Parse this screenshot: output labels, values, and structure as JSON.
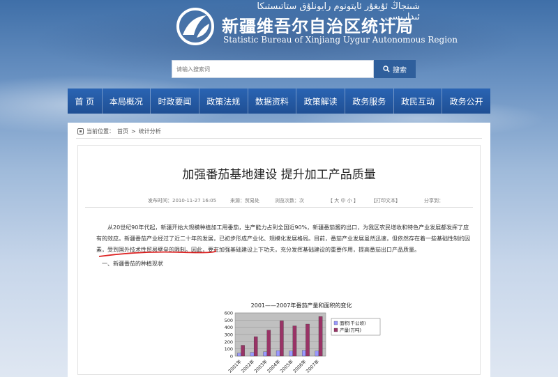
{
  "header": {
    "uyghur_title": "شىنجاڭ ئۇيغۇر ئاپتونوم رايونلۇق ستاتىستىكا ئىدارىسى",
    "title": "新疆维吾尔自治区统计局",
    "title_en": "Statistic Bureau of Xinjiang Uygur Autonomous Region"
  },
  "search": {
    "placeholder": "请输入搜索词",
    "button_label": "搜索"
  },
  "nav": {
    "items": [
      "首 页",
      "本局概况",
      "时政要闻",
      "政策法规",
      "数据资料",
      "政策解读",
      "政务服务",
      "政民互动",
      "政务公开"
    ]
  },
  "breadcrumb": {
    "label": "当前位置：",
    "home": "首页",
    "sep": " > ",
    "section": "统计分析"
  },
  "article": {
    "title": "加强番茄基地建设 提升加工产品质量",
    "publish": "发布时间：2010-11-27 16:05",
    "source": "来源：贸易处",
    "views": "浏览次数：次",
    "font_size": "【 大  中  小 】",
    "print": "【打印文本】",
    "share": "分享到：",
    "para1": "从20世纪90年代起，新疆开始大规模种植加工用番茄，生产能力占到全国近90%，新疆番茄酱的出口，为我区农民增收和特色产业发展都发挥了应有的效应。新疆番茄产业经过了近二十年的发展，已初步形成产业化、规模化发展格局。目前，番茄产业发展虽然迅速，但依然存在着一些基础性制约因素，受到国外技术性贸易壁垒的限制。因此，要在加强基础建设上下功夫，充分发挥基础建设的重要作用，提高番茄出口产品质量。",
    "section1": "一、新疆番茄的种植现状"
  },
  "chart_data": {
    "type": "bar",
    "title": "2001——2007年番茄产量和面积的变化",
    "categories": [
      "2001年",
      "2002年",
      "2003年",
      "2004年",
      "2005年",
      "2006年",
      "2007年"
    ],
    "series": [
      {
        "name": "面积(千公顷)",
        "values": [
          40,
          50,
          60,
          75,
          70,
          80,
          70
        ],
        "color": "#9a99ff"
      },
      {
        "name": "产量(万吨)",
        "values": [
          150,
          270,
          360,
          490,
          420,
          445,
          550
        ],
        "color": "#993366"
      }
    ],
    "ylim": [
      0,
      600
    ],
    "yticks": [
      "0",
      "100",
      "200",
      "300",
      "400",
      "500",
      "600"
    ],
    "legend": "right",
    "grid": true
  }
}
